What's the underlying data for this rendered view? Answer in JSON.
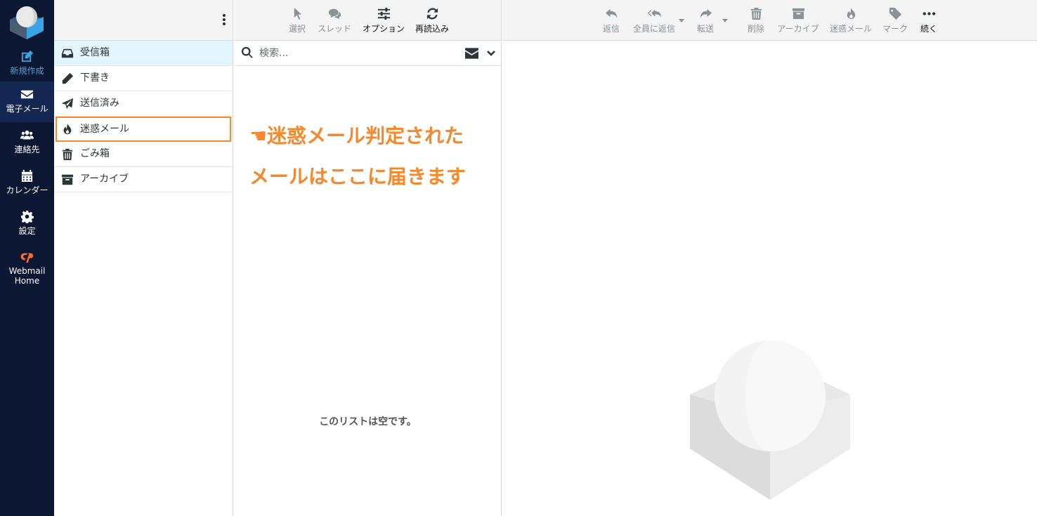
{
  "nav": {
    "compose": "新規作成",
    "mail": "電子メール",
    "contacts": "連絡先",
    "calendar": "カレンダー",
    "settings": "設定",
    "webmail_home_line1": "Webmail",
    "webmail_home_line2": "Home"
  },
  "folders": [
    {
      "label": "受信箱",
      "icon": "inbox-icon"
    },
    {
      "label": "下書き",
      "icon": "pencil-icon"
    },
    {
      "label": "送信済み",
      "icon": "paper-plane-icon"
    },
    {
      "label": "迷惑メール",
      "icon": "fire-icon"
    },
    {
      "label": "ごみ箱",
      "icon": "trash-icon"
    },
    {
      "label": "アーカイブ",
      "icon": "archive-icon"
    }
  ],
  "list_toolbar": {
    "select": "選択",
    "threads": "スレッド",
    "options": "オプション",
    "refresh": "再読込み"
  },
  "search": {
    "placeholder": "検索..."
  },
  "annotation": {
    "line1": "☚迷惑メール判定された",
    "line2": "メールはここに届きます"
  },
  "list_empty": "このリストは空です。",
  "preview_toolbar": {
    "reply": "返信",
    "reply_all": "全員に返信",
    "forward": "転送",
    "delete": "削除",
    "archive": "アーカイブ",
    "junk": "迷惑メール",
    "mark": "マーク",
    "more": "続く"
  },
  "colors": {
    "rail_bg": "#0c1733",
    "accent_blue": "#37a5e5",
    "annotation_orange": "#f5882c",
    "selected_bg": "#e3f6fd"
  }
}
